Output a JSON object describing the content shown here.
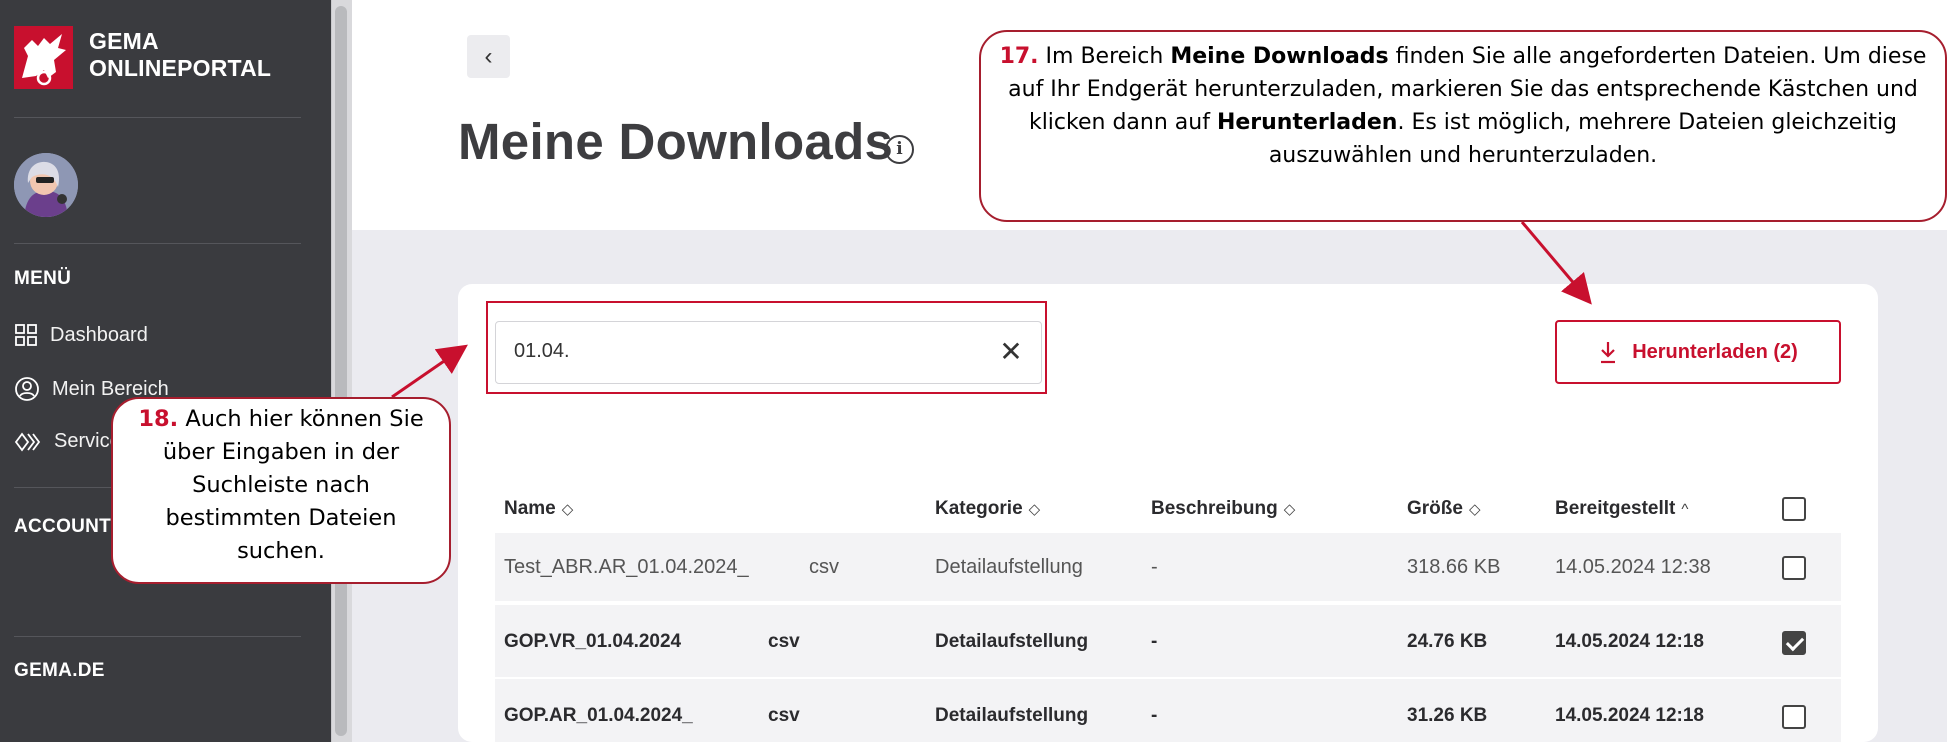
{
  "sidebar": {
    "logo_line1": "GEMA",
    "logo_line2": "ONLINEPORTAL",
    "menu_heading": "MENÜ",
    "items": [
      {
        "label": "Dashboard",
        "icon": "grid-icon"
      },
      {
        "label": "Mein Bereich",
        "icon": "user-circle-icon"
      },
      {
        "label": "Service",
        "icon": "service-chevrons-icon"
      }
    ],
    "account_heading": "ACCOUNT",
    "gema_de": "GEMA.DE"
  },
  "header": {
    "back_icon": "‹",
    "title": "Meine Downloads",
    "info_icon": "i"
  },
  "search": {
    "value": "01.04.",
    "clear_icon": "✕"
  },
  "toolbar": {
    "download_label": "Herunterladen (2)",
    "download_icon": "↓"
  },
  "table": {
    "columns": [
      {
        "label": "Name",
        "sort": "◇"
      },
      {
        "label": "Kategorie",
        "sort": "◇"
      },
      {
        "label": "Beschreibung",
        "sort": "◇"
      },
      {
        "label": "Größe",
        "sort": "◇"
      },
      {
        "label": "Bereitgestellt",
        "sort": "^"
      }
    ],
    "rows": [
      {
        "name": "Test_ABR.AR_01.04.2024_",
        "ext": "csv",
        "kategorie": "Detailaufstellung",
        "beschreibung": "-",
        "groesse": "318.66 KB",
        "bereitgestellt": "14.05.2024 12:38",
        "checked": false,
        "bold": false
      },
      {
        "name": "GOP.VR_01.04.2024",
        "ext": "csv",
        "kategorie": "Detailaufstellung",
        "beschreibung": "-",
        "groesse": "24.76 KB",
        "bereitgestellt": "14.05.2024 12:18",
        "checked": true,
        "bold": true
      },
      {
        "name": "GOP.AR_01.04.2024_",
        "ext": "csv",
        "kategorie": "Detailaufstellung",
        "beschreibung": "-",
        "groesse": "31.26 KB",
        "bereitgestellt": "14.05.2024 12:18",
        "checked": false,
        "bold": true
      }
    ]
  },
  "callout17": {
    "num": "17.",
    "t1": " Im Bereich ",
    "b1": "Meine Downloads",
    "t2": " finden Sie alle angeforderten Dateien. Um diese auf Ihr Endgerät herunterzuladen, markieren Sie das entsprechende Kästchen und klicken dann auf ",
    "b2": "Herunterladen",
    "t3": ". Es ist möglich, mehrere Dateien gleichzeitig auszuwählen und herunterzuladen."
  },
  "callout18": {
    "num": "18.",
    "text": " Auch hier können Sie über Eingaben in der Suchleiste nach bestimmten Dateien suchen."
  },
  "colors": {
    "sidebar_bg": "#3a3b3f",
    "accent_red": "#c8102e",
    "content_bg": "#ebebf0"
  }
}
